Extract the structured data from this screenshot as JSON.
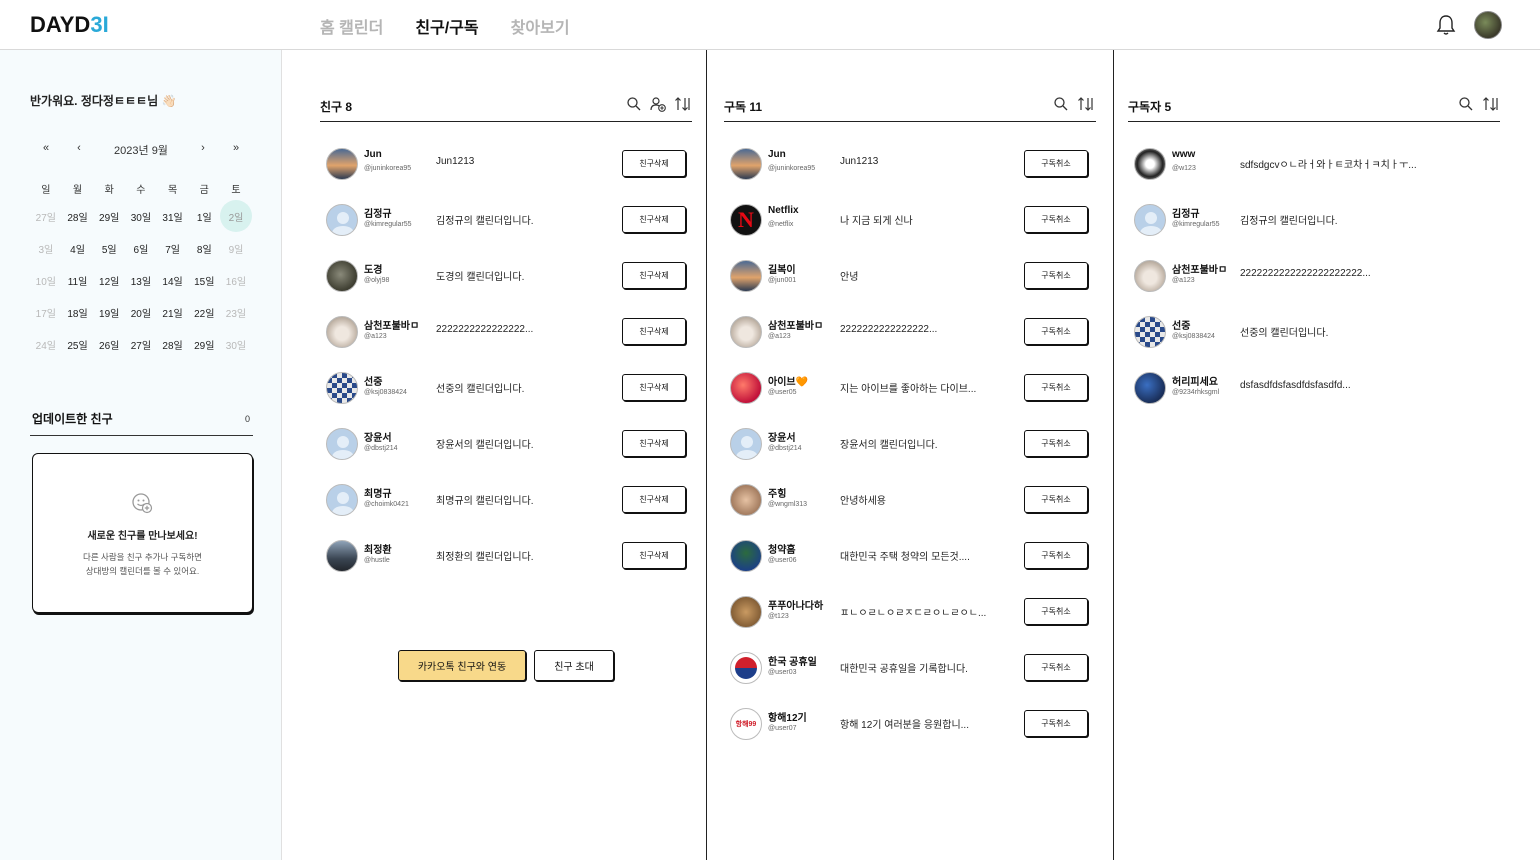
{
  "header": {
    "logo_main": "DAYD",
    "logo_accent": "3I",
    "nav": [
      "홈 캘린더",
      "친구/구독",
      "찾아보기"
    ]
  },
  "sidebar": {
    "greeting": "반가워요. 정다정ㅌㅌㅌ님 👋🏻",
    "calendar": {
      "prev_year": "«",
      "prev_month": "‹",
      "month": "2023년 9월",
      "next_month": "›",
      "next_year": "»",
      "weekdays": [
        "일",
        "월",
        "화",
        "수",
        "목",
        "금",
        "토"
      ],
      "weeks": [
        [
          "27일",
          "28일",
          "29일",
          "30일",
          "31일",
          "1일",
          "2일"
        ],
        [
          "3일",
          "4일",
          "5일",
          "6일",
          "7일",
          "8일",
          "9일"
        ],
        [
          "10일",
          "11일",
          "12일",
          "13일",
          "14일",
          "15일",
          "16일"
        ],
        [
          "17일",
          "18일",
          "19일",
          "20일",
          "21일",
          "22일",
          "23일"
        ],
        [
          "24일",
          "25일",
          "26일",
          "27일",
          "28일",
          "29일",
          "30일"
        ]
      ]
    },
    "updated": {
      "title": "업데이트한 친구",
      "count": "0",
      "empty_title": "새로운 친구를 만나보세요!",
      "empty_desc_1": "다른 사람을 친구 추가나 구독하면",
      "empty_desc_2": "상대방의 캘린더를 볼 수 있어요."
    }
  },
  "friends": {
    "title": "친구 8",
    "button_label": "친구삭제",
    "kakao_label": "카카오톡 친구와 연동",
    "invite_label": "친구 초대",
    "items": [
      {
        "name": "Jun",
        "handle": "@juninkorea95",
        "bio": "Jun1213",
        "avatar": "sunset"
      },
      {
        "name": "김정규",
        "handle": "@kimregular55",
        "bio": "김정규의 캘린더입니다.",
        "avatar": "default"
      },
      {
        "name": "도경",
        "handle": "@olyj98",
        "bio": "도경의 캘린더입니다.",
        "avatar": "gray"
      },
      {
        "name": "삼천포불바ㅁ",
        "handle": "@a123",
        "bio": "2222222222222222...",
        "avatar": "bear"
      },
      {
        "name": "선중",
        "handle": "@ksj0838424",
        "bio": "선중의 캘린더입니다.",
        "avatar": "check"
      },
      {
        "name": "장윤서",
        "handle": "@dbstj214",
        "bio": "장윤서의 캘린더입니다.",
        "avatar": "default"
      },
      {
        "name": "최명규",
        "handle": "@choimk0421",
        "bio": "최명규의 캘린더입니다.",
        "avatar": "default"
      },
      {
        "name": "최정환",
        "handle": "@hustle",
        "bio": "최정환의 캘린더입니다.",
        "avatar": "balloon"
      }
    ]
  },
  "subscriptions": {
    "title": "구독 11",
    "button_label": "구독취소",
    "items": [
      {
        "name": "Jun",
        "handle": "@juninkorea95",
        "bio": "Jun1213",
        "avatar": "sunset"
      },
      {
        "name": "Netflix",
        "handle": "@netflix",
        "bio": "나 지금 되게 신나",
        "avatar": "netflix"
      },
      {
        "name": "길복이",
        "handle": "@jun001",
        "bio": "안녕",
        "avatar": "sunset"
      },
      {
        "name": "삼천포불바ㅁ",
        "handle": "@a123",
        "bio": "2222222222222222...",
        "avatar": "bear"
      },
      {
        "name": "아이브",
        "handle": "@user05",
        "bio": "지는 아이브를 좋아하는 다이브...",
        "avatar": "red",
        "heart": "🧡"
      },
      {
        "name": "장윤서",
        "handle": "@dbstj214",
        "bio": "장윤서의 캘린더입니다.",
        "avatar": "default"
      },
      {
        "name": "주힝",
        "handle": "@wngml313",
        "bio": "안녕하세용",
        "avatar": "hand"
      },
      {
        "name": "청약홈",
        "handle": "@user06",
        "bio": "대한민국 주택 청약의 모든것....",
        "avatar": "gov"
      },
      {
        "name": "푸푸아나다하",
        "handle": "@t123",
        "bio": "ㅍㄴㅇㄹㄴㅇㄹㅈㄷㄹㅇㄴㄹㅇㄴ...",
        "avatar": "bear2"
      },
      {
        "name": "한국 공휴일",
        "handle": "@user03",
        "bio": "대한민국 공휴일을 기록합니다.",
        "avatar": "korea"
      },
      {
        "name": "항해12기",
        "handle": "@user07",
        "bio": "항해 12기 여러분을 응원합니...",
        "avatar": "hh",
        "avatar_text": "항해99"
      }
    ]
  },
  "subscribers": {
    "title": "구독자 5",
    "items": [
      {
        "name": "www",
        "handle": "@w123",
        "bio": "sdfsdgcvㅇㄴ라ㅓ와ㅏㅌ코차ㅓㅋ치ㅏㅜ...",
        "avatar": "www"
      },
      {
        "name": "김정규",
        "handle": "@kimregular55",
        "bio": "김정규의 캘린더입니다.",
        "avatar": "default"
      },
      {
        "name": "삼천포불바ㅁ",
        "handle": "@a123",
        "bio": "2222222222222222222222...",
        "avatar": "bear"
      },
      {
        "name": "선중",
        "handle": "@ksj0838424",
        "bio": "선중의 캘린더입니다.",
        "avatar": "check"
      },
      {
        "name": "허리피세요",
        "handle": "@9234rhksgml",
        "bio": "dsfasdfdsfasdfdsfasdfd...",
        "avatar": "earth"
      }
    ]
  }
}
